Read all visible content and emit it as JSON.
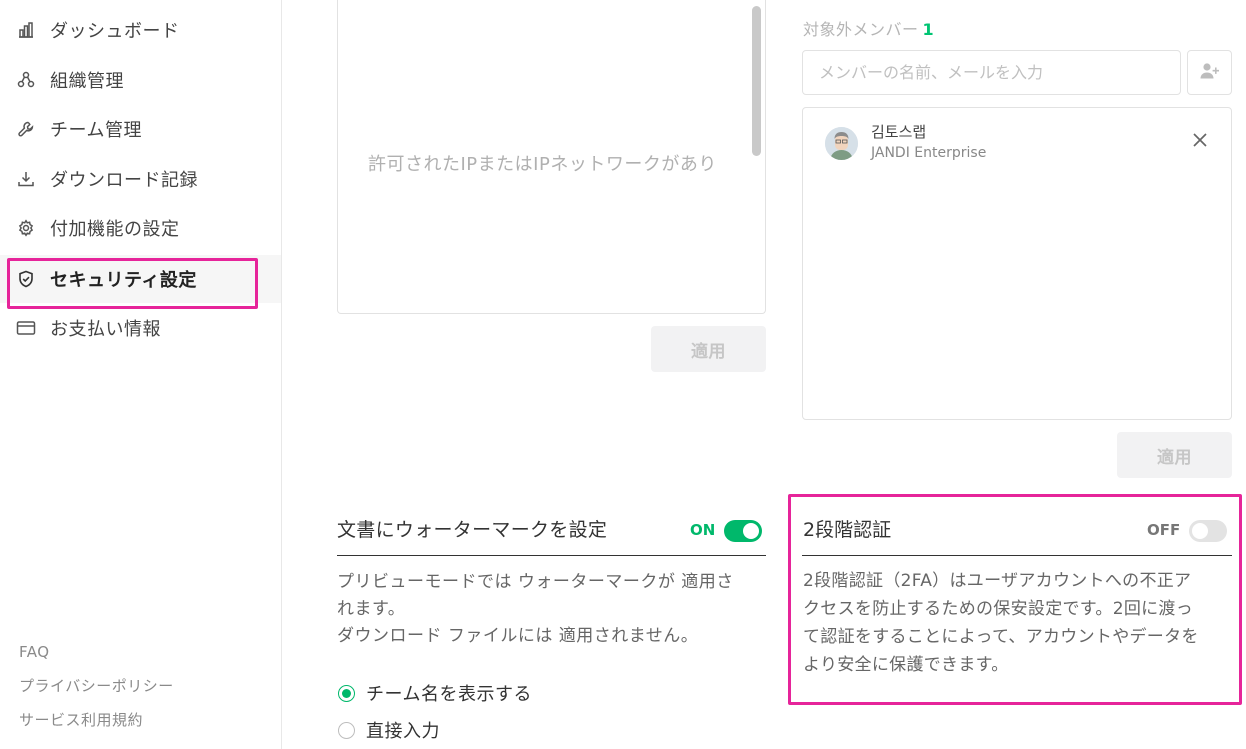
{
  "sidebar": {
    "items": [
      {
        "label": "ダッシュボード",
        "icon": "bar-chart-icon"
      },
      {
        "label": "組織管理",
        "icon": "org-chart-icon"
      },
      {
        "label": "チーム管理",
        "icon": "wrench-icon"
      },
      {
        "label": "ダウンロード記録",
        "icon": "download-icon"
      },
      {
        "label": "付加機能の設定",
        "icon": "gear-icon"
      },
      {
        "label": "セキュリティ設定",
        "icon": "shield-icon",
        "active": true
      },
      {
        "label": "お支払い情報",
        "icon": "credit-card-icon"
      }
    ],
    "footer": [
      "FAQ",
      "プライバシーポリシー",
      "サービス利用規約"
    ]
  },
  "ip_allow": {
    "placeholder": "許可されたIPまたはIPネットワークがあり",
    "apply_label": "適用"
  },
  "exempt_members": {
    "title": "対象外メンバー",
    "count": "1",
    "search_placeholder": "メンバーの名前、メールを入力",
    "members": [
      {
        "name": "김토스랩",
        "company": "JANDI Enterprise"
      }
    ],
    "apply_label": "適用"
  },
  "watermark": {
    "title": "文書にウォーターマークを設定",
    "status": "ON",
    "enabled": true,
    "description": [
      "プリビューモードでは ウォーターマークが 適用さ",
      "れます。",
      "ダウンロード ファイルには 適用されません。"
    ],
    "options": [
      {
        "label": "チーム名を表示する",
        "checked": true
      },
      {
        "label": "直接入力",
        "checked": false
      }
    ]
  },
  "two_factor": {
    "title": "2段階認証",
    "status": "OFF",
    "enabled": false,
    "description": [
      "2段階認証（2FA）はユーザアカウントへの不正ア",
      "クセスを防止するための保安設定です。2回に渡っ",
      "て認証をすることによって、アカウントやデータを",
      "より安全に保護できます。"
    ]
  },
  "colors": {
    "accent_green": "#00b86b",
    "highlight_pink": "#e6249a"
  }
}
